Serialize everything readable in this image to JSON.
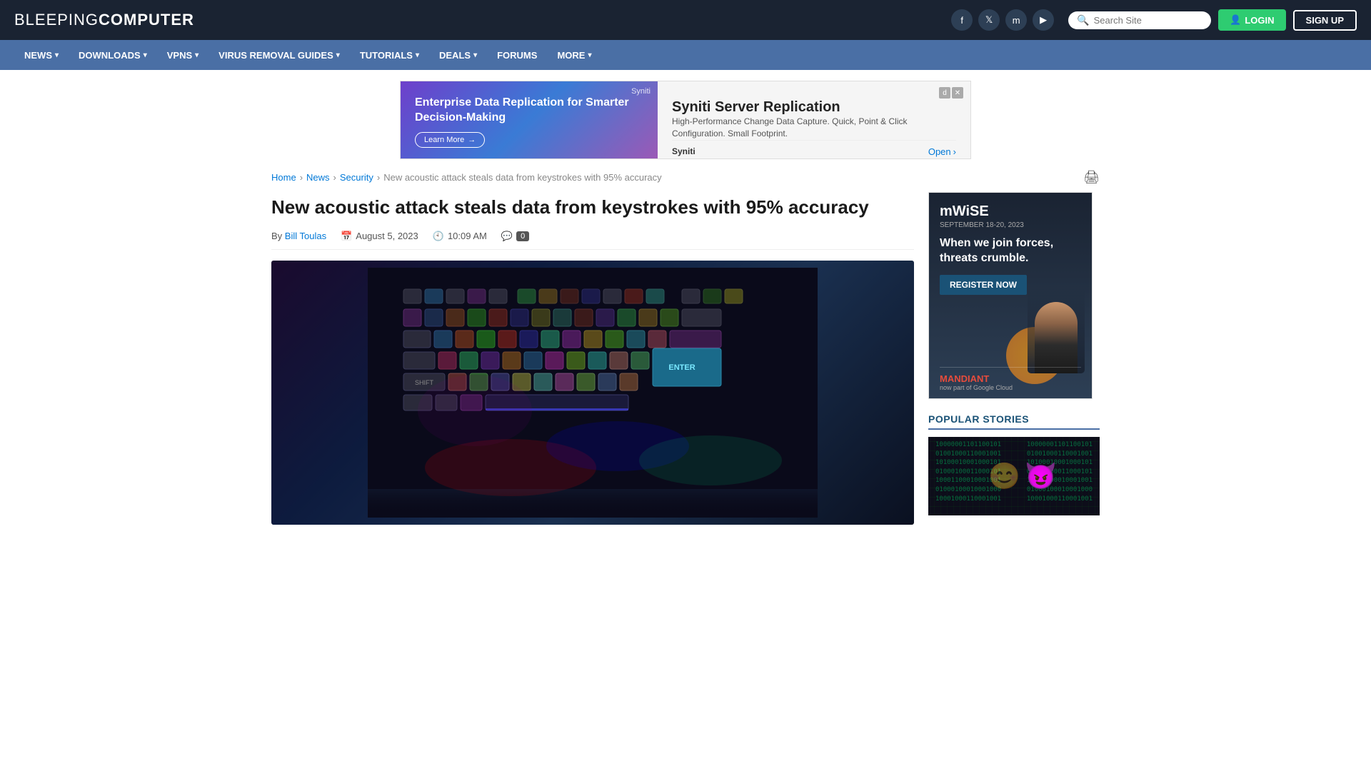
{
  "site": {
    "name_light": "BLEEPING",
    "name_bold": "COMPUTER"
  },
  "header": {
    "search_placeholder": "Search Site",
    "login_label": "LOGIN",
    "signup_label": "SIGN UP"
  },
  "nav": {
    "items": [
      {
        "label": "NEWS",
        "has_dropdown": true
      },
      {
        "label": "DOWNLOADS",
        "has_dropdown": true
      },
      {
        "label": "VPNS",
        "has_dropdown": true
      },
      {
        "label": "VIRUS REMOVAL GUIDES",
        "has_dropdown": true
      },
      {
        "label": "TUTORIALS",
        "has_dropdown": true
      },
      {
        "label": "DEALS",
        "has_dropdown": true
      },
      {
        "label": "FORUMS",
        "has_dropdown": false
      },
      {
        "label": "MORE",
        "has_dropdown": true
      }
    ]
  },
  "ad": {
    "brand": "Syniti",
    "headline": "Enterprise Data Replication for Smarter Decision-Making",
    "learn_more": "Learn More",
    "title": "Syniti Server Replication",
    "description": "High-Performance Change Data Capture. Quick, Point & Click Configuration. Small Footprint.",
    "open_label": "Open"
  },
  "breadcrumb": {
    "home": "Home",
    "news": "News",
    "security": "Security",
    "current": "New acoustic attack steals data from keystrokes with 95% accuracy"
  },
  "article": {
    "title": "New acoustic attack steals data from keystrokes with 95% accuracy",
    "author": "Bill Toulas",
    "date": "August 5, 2023",
    "time": "10:09 AM",
    "comments": "0"
  },
  "sidebar_ad": {
    "logo": "mWiSE",
    "date": "SEPTEMBER 18-20, 2023",
    "tagline": "When we join forces, threats crumble.",
    "cta": "REGISTER NOW",
    "brand": "MANDIANT",
    "brand_sub": "now part of Google Cloud"
  },
  "popular": {
    "title": "POPULAR STORIES"
  }
}
